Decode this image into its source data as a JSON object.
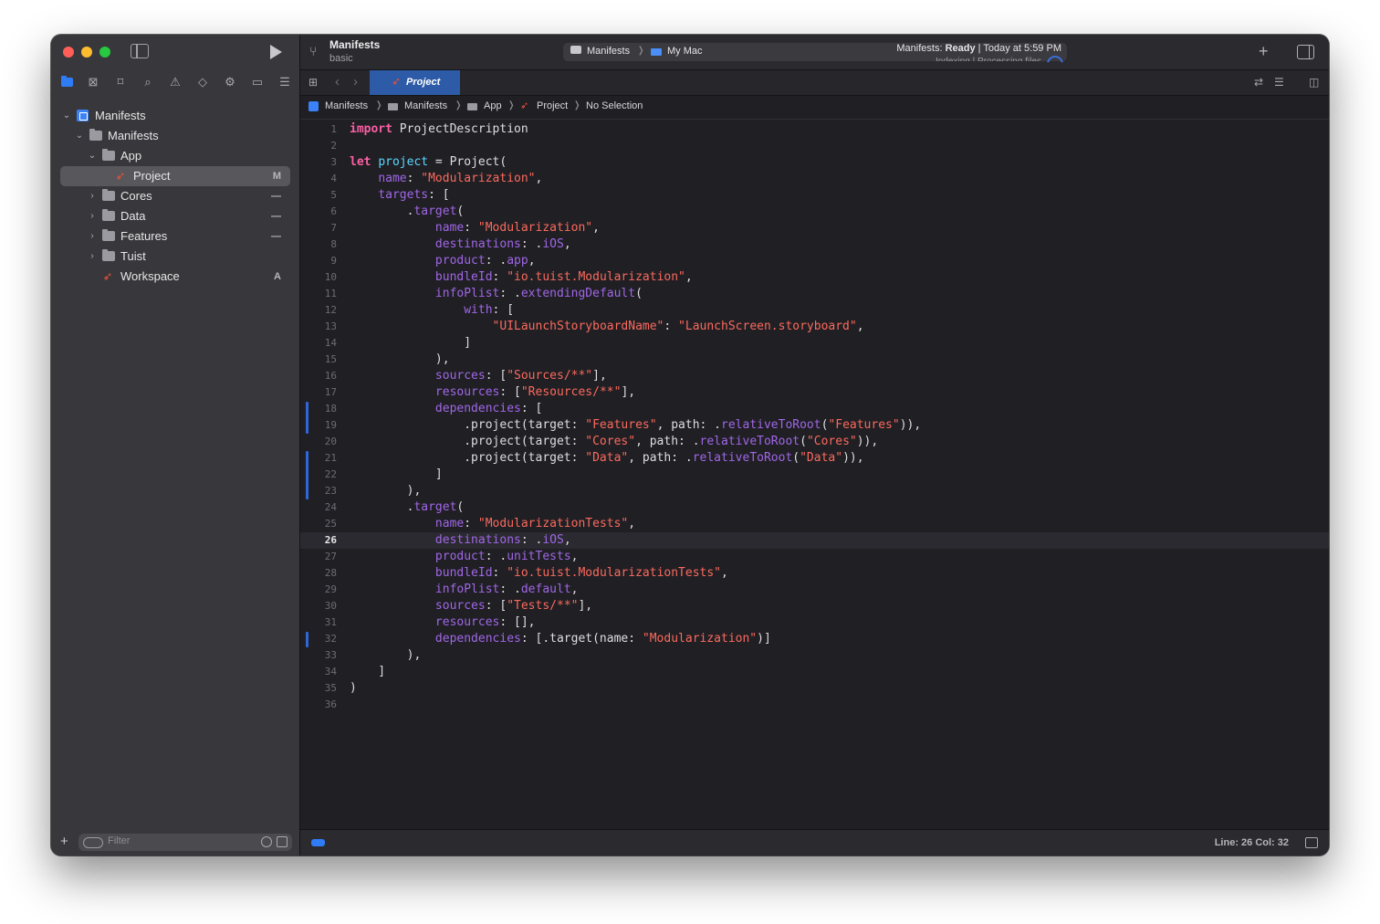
{
  "toolbar": {
    "project_title": "Manifests",
    "project_subtitle": "basic",
    "scheme_app": "Manifests",
    "scheme_destination": "My Mac",
    "status_prefix": "Manifests: ",
    "status_state": "Ready",
    "status_time": " | Today at 5:59 PM",
    "status_sub": "Indexing | Processing files"
  },
  "tab": {
    "label": "Project"
  },
  "jumpbar": {
    "crumbs": [
      "Manifests",
      "Manifests",
      "App",
      "Project",
      "No Selection"
    ]
  },
  "navigator": {
    "items": [
      {
        "label": "Manifests",
        "badge": "",
        "icon": "project-icon"
      },
      {
        "label": "Manifests",
        "badge": "",
        "icon": "folder-icon"
      },
      {
        "label": "App",
        "badge": "",
        "icon": "folder-icon"
      },
      {
        "label": "Project",
        "badge": "M",
        "icon": "swift-icon"
      },
      {
        "label": "Cores",
        "badge": "—",
        "icon": "folder-icon"
      },
      {
        "label": "Data",
        "badge": "—",
        "icon": "folder-icon"
      },
      {
        "label": "Features",
        "badge": "—",
        "icon": "folder-icon"
      },
      {
        "label": "Tuist",
        "badge": "",
        "icon": "folder-icon"
      },
      {
        "label": "Workspace",
        "badge": "A",
        "icon": "swift-icon"
      }
    ],
    "filter_placeholder": "Filter"
  },
  "editor": {
    "lines": [
      "1",
      "2",
      "3",
      "4",
      "5",
      "6",
      "7",
      "8",
      "9",
      "10",
      "11",
      "12",
      "13",
      "14",
      "15",
      "16",
      "17",
      "18",
      "19",
      "20",
      "21",
      "22",
      "23",
      "24",
      "25",
      "26",
      "27",
      "28",
      "29",
      "30",
      "31",
      "32",
      "33",
      "34",
      "35",
      "36"
    ],
    "current_line": 26
  },
  "statusbar": {
    "position": "Line: 26  Col: 32"
  },
  "colors": {
    "keyword": "#fc5fa3",
    "string": "#fc6a5d",
    "property": "#a167e6",
    "declaration": "#5dd8ff",
    "accent": "#2f7cf6"
  }
}
